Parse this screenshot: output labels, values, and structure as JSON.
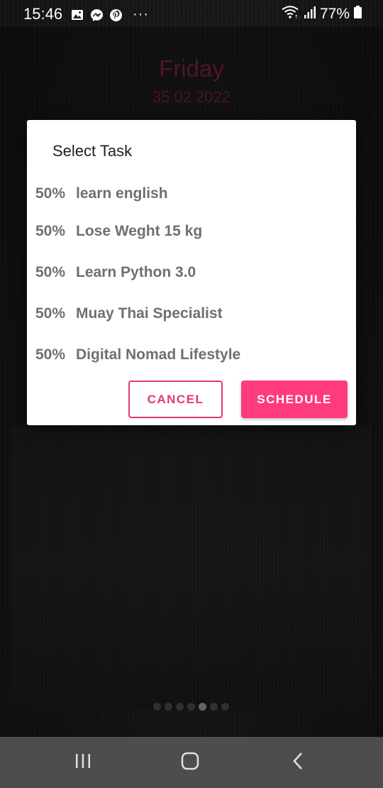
{
  "status_bar": {
    "time": "15:46",
    "battery": "77%",
    "icons_left": [
      "image-icon",
      "messenger-icon",
      "pinterest-icon",
      "more-dots-icon"
    ],
    "icons_right": [
      "wifi-icon",
      "signal-icon",
      "battery-icon"
    ]
  },
  "header": {
    "day": "Friday",
    "date": "35 02 2022"
  },
  "dialog": {
    "title": "Select Task",
    "tasks": [
      {
        "percent": "50%",
        "name": "learn english"
      },
      {
        "percent": "50%",
        "name": "Lose Weght 15 kg"
      },
      {
        "percent": "50%",
        "name": "Learn Python 3.0"
      },
      {
        "percent": "50%",
        "name": "Muay Thai Specialist"
      },
      {
        "percent": "50%",
        "name": "Digital Nomad Lifestyle"
      }
    ],
    "cancel_label": "CANCEL",
    "schedule_label": "SCHEDULE"
  },
  "page_indicator": {
    "count": 7,
    "active_index": 4
  },
  "nav_bar": {
    "items": [
      "recents-icon",
      "home-icon",
      "back-icon"
    ]
  },
  "colors": {
    "accent": "#ff3b7f",
    "accent_outline": "#e2386e",
    "date_text": "#7a2340"
  }
}
